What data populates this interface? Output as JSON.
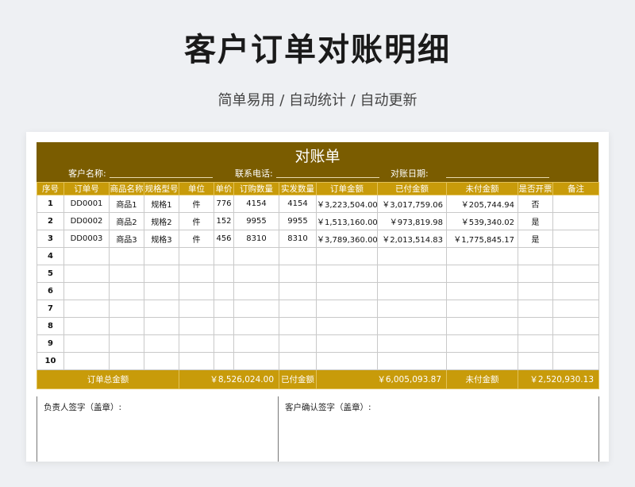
{
  "page": {
    "title": "客户订单对账明细",
    "subtitle": "简单易用 / 自动统计 / 自动更新"
  },
  "form": {
    "title": "对账单",
    "customer_name_label": "客户名称:",
    "phone_label": "联系电话:",
    "date_label": "对账日期:"
  },
  "table": {
    "headers": [
      "序号",
      "订单号",
      "商品名称",
      "规格型号",
      "单位",
      "单价",
      "订购数量",
      "实发数量",
      "订单金额",
      "已付金额",
      "未付金额",
      "是否开票",
      "备注"
    ],
    "rows": [
      [
        "1",
        "DD0001",
        "商品1",
        "规格1",
        "件",
        "776",
        "4154",
        "4154",
        "￥3,223,504.00",
        "￥3,017,759.06",
        "￥205,744.94",
        "否",
        ""
      ],
      [
        "2",
        "DD0002",
        "商品2",
        "规格2",
        "件",
        "152",
        "9955",
        "9955",
        "￥1,513,160.00",
        "￥973,819.98",
        "￥539,340.02",
        "是",
        ""
      ],
      [
        "3",
        "DD0003",
        "商品3",
        "规格3",
        "件",
        "456",
        "8310",
        "8310",
        "￥3,789,360.00",
        "￥2,013,514.83",
        "￥1,775,845.17",
        "是",
        ""
      ],
      [
        "4",
        "",
        "",
        "",
        "",
        "",
        "",
        "",
        "",
        "",
        "",
        "",
        ""
      ],
      [
        "5",
        "",
        "",
        "",
        "",
        "",
        "",
        "",
        "",
        "",
        "",
        "",
        ""
      ],
      [
        "6",
        "",
        "",
        "",
        "",
        "",
        "",
        "",
        "",
        "",
        "",
        "",
        ""
      ],
      [
        "7",
        "",
        "",
        "",
        "",
        "",
        "",
        "",
        "",
        "",
        "",
        "",
        ""
      ],
      [
        "8",
        "",
        "",
        "",
        "",
        "",
        "",
        "",
        "",
        "",
        "",
        "",
        ""
      ],
      [
        "9",
        "",
        "",
        "",
        "",
        "",
        "",
        "",
        "",
        "",
        "",
        "",
        ""
      ],
      [
        "10",
        "",
        "",
        "",
        "",
        "",
        "",
        "",
        "",
        "",
        "",
        "",
        ""
      ]
    ]
  },
  "totals": {
    "order_total_label": "订单总金额",
    "order_total_value": "￥8,526,024.00",
    "paid_label": "已付金额",
    "paid_value": "￥6,005,093.87",
    "unpaid_label": "未付金额",
    "unpaid_value": "￥2,520,930.13"
  },
  "signatures": {
    "left_label": "负责人签字（盖章）:",
    "right_label": "客户确认签字（盖章）:"
  },
  "colors": {
    "header_band": "#7a5c00",
    "header_row": "#c89b0a",
    "page_background": "#eef0f3"
  }
}
